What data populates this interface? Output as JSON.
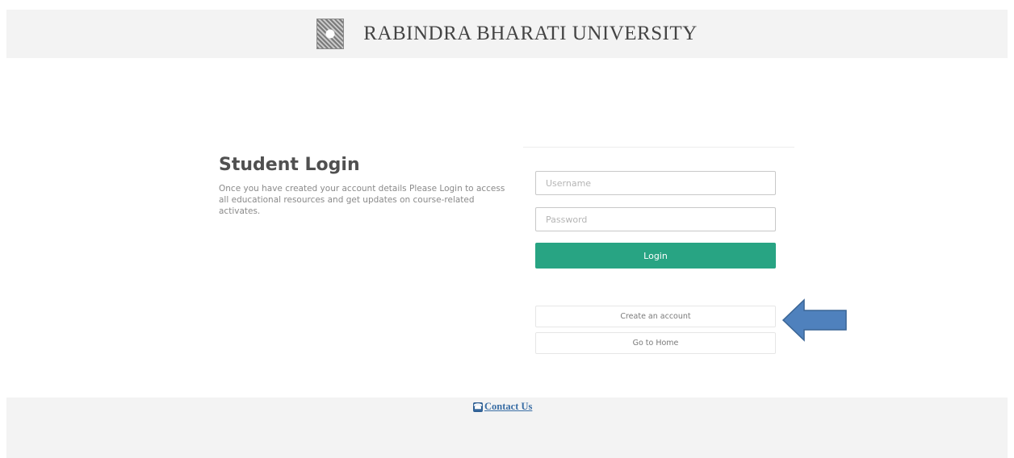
{
  "header": {
    "university_name": "RABINDRA BHARATI UNIVERSITY",
    "logo_icon": "university-emblem"
  },
  "intro": {
    "title": "Student Login",
    "description": "Once you have created your account details Please Login to access all educational resources and get updates on course-related activates."
  },
  "form": {
    "username_placeholder": "Username",
    "password_placeholder": "Password",
    "login_label": "Login",
    "create_account_label": "Create an account",
    "go_home_label": "Go to Home",
    "accent_color": "#28a483"
  },
  "annotation": {
    "arrow_color": "#4f81bd",
    "arrow_direction": "left"
  },
  "footer": {
    "contact_label": "Contact Us",
    "contact_icon": "phone-icon"
  }
}
